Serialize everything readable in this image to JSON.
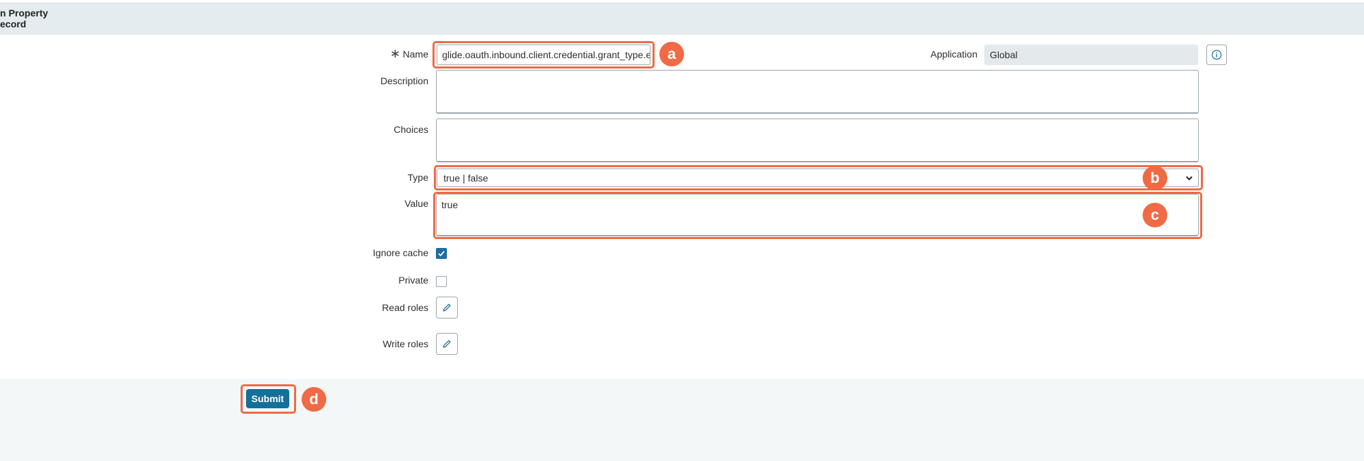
{
  "header": {
    "title": "n Property\necord"
  },
  "form": {
    "name": {
      "label": "Name",
      "value": "glide.oauth.inbound.client.credential.grant_type.e",
      "required_mark": "∗"
    },
    "application": {
      "label": "Application",
      "value": "Global"
    },
    "description": {
      "label": "Description",
      "value": ""
    },
    "choices": {
      "label": "Choices",
      "value": ""
    },
    "type": {
      "label": "Type",
      "value": "true | false"
    },
    "value": {
      "label": "Value",
      "value": "true"
    },
    "ignore_cache": {
      "label": "Ignore cache",
      "checked": true
    },
    "private": {
      "label": "Private",
      "checked": false
    },
    "read_roles": {
      "label": "Read roles"
    },
    "write_roles": {
      "label": "Write roles"
    }
  },
  "footer": {
    "submit_label": "Submit"
  },
  "annotations": {
    "a": "a",
    "b": "b",
    "c": "c",
    "d": "d"
  },
  "icons": {
    "info": "info-icon",
    "edit_read": "pencil-icon",
    "edit_write": "pencil-icon",
    "check": "check-icon",
    "chevron": "chevron-down-icon"
  },
  "colors": {
    "accent": "#146f99",
    "highlight": "#ef6a45",
    "header_bg": "#e4ecef"
  }
}
